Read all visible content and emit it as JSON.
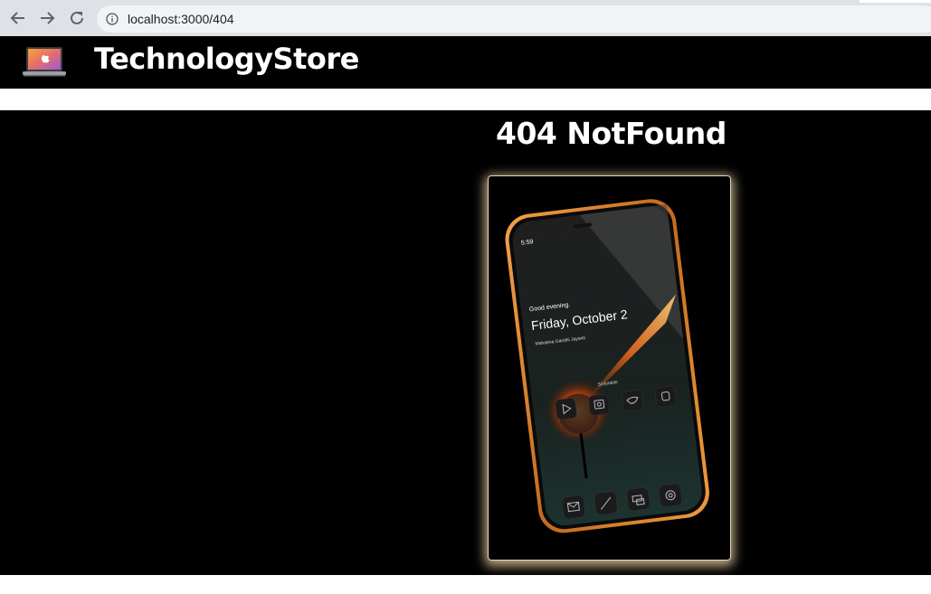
{
  "browser": {
    "url": "localhost:3000/404",
    "icons": [
      "back-arrow-icon",
      "forward-arrow-icon",
      "reload-icon",
      "info-icon"
    ]
  },
  "header": {
    "brand": "TechnologyStore",
    "logo_icon": "laptop-apple-logo-icon",
    "background": "#000000"
  },
  "main": {
    "heading": "404 NotFound",
    "image": {
      "description_icon": "smartphone-photo",
      "phone_time": "5:59",
      "greeting": "Good evening.",
      "date": "Friday, October 2",
      "holiday": "Mahatma Gandhi Jayanti",
      "widget_label": "Scriptable"
    }
  },
  "colors": {
    "accent_glow": "#ffe6b4",
    "phone_frame": "#e08a2a",
    "text": "#ffffff"
  }
}
